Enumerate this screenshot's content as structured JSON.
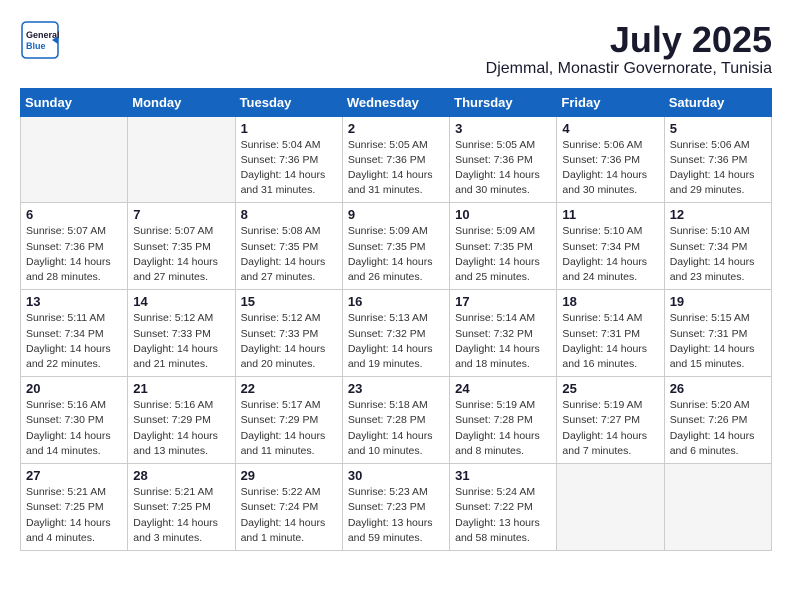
{
  "header": {
    "logo_general": "General",
    "logo_blue": "Blue",
    "month": "July 2025",
    "location": "Djemmal, Monastir Governorate, Tunisia"
  },
  "weekdays": [
    "Sunday",
    "Monday",
    "Tuesday",
    "Wednesday",
    "Thursday",
    "Friday",
    "Saturday"
  ],
  "weeks": [
    [
      {
        "day": "",
        "empty": true
      },
      {
        "day": "",
        "empty": true
      },
      {
        "day": "1",
        "sunrise": "5:04 AM",
        "sunset": "7:36 PM",
        "daylight": "14 hours and 31 minutes."
      },
      {
        "day": "2",
        "sunrise": "5:05 AM",
        "sunset": "7:36 PM",
        "daylight": "14 hours and 31 minutes."
      },
      {
        "day": "3",
        "sunrise": "5:05 AM",
        "sunset": "7:36 PM",
        "daylight": "14 hours and 30 minutes."
      },
      {
        "day": "4",
        "sunrise": "5:06 AM",
        "sunset": "7:36 PM",
        "daylight": "14 hours and 30 minutes."
      },
      {
        "day": "5",
        "sunrise": "5:06 AM",
        "sunset": "7:36 PM",
        "daylight": "14 hours and 29 minutes."
      }
    ],
    [
      {
        "day": "6",
        "sunrise": "5:07 AM",
        "sunset": "7:36 PM",
        "daylight": "14 hours and 28 minutes."
      },
      {
        "day": "7",
        "sunrise": "5:07 AM",
        "sunset": "7:35 PM",
        "daylight": "14 hours and 27 minutes."
      },
      {
        "day": "8",
        "sunrise": "5:08 AM",
        "sunset": "7:35 PM",
        "daylight": "14 hours and 27 minutes."
      },
      {
        "day": "9",
        "sunrise": "5:09 AM",
        "sunset": "7:35 PM",
        "daylight": "14 hours and 26 minutes."
      },
      {
        "day": "10",
        "sunrise": "5:09 AM",
        "sunset": "7:35 PM",
        "daylight": "14 hours and 25 minutes."
      },
      {
        "day": "11",
        "sunrise": "5:10 AM",
        "sunset": "7:34 PM",
        "daylight": "14 hours and 24 minutes."
      },
      {
        "day": "12",
        "sunrise": "5:10 AM",
        "sunset": "7:34 PM",
        "daylight": "14 hours and 23 minutes."
      }
    ],
    [
      {
        "day": "13",
        "sunrise": "5:11 AM",
        "sunset": "7:34 PM",
        "daylight": "14 hours and 22 minutes."
      },
      {
        "day": "14",
        "sunrise": "5:12 AM",
        "sunset": "7:33 PM",
        "daylight": "14 hours and 21 minutes."
      },
      {
        "day": "15",
        "sunrise": "5:12 AM",
        "sunset": "7:33 PM",
        "daylight": "14 hours and 20 minutes."
      },
      {
        "day": "16",
        "sunrise": "5:13 AM",
        "sunset": "7:32 PM",
        "daylight": "14 hours and 19 minutes."
      },
      {
        "day": "17",
        "sunrise": "5:14 AM",
        "sunset": "7:32 PM",
        "daylight": "14 hours and 18 minutes."
      },
      {
        "day": "18",
        "sunrise": "5:14 AM",
        "sunset": "7:31 PM",
        "daylight": "14 hours and 16 minutes."
      },
      {
        "day": "19",
        "sunrise": "5:15 AM",
        "sunset": "7:31 PM",
        "daylight": "14 hours and 15 minutes."
      }
    ],
    [
      {
        "day": "20",
        "sunrise": "5:16 AM",
        "sunset": "7:30 PM",
        "daylight": "14 hours and 14 minutes."
      },
      {
        "day": "21",
        "sunrise": "5:16 AM",
        "sunset": "7:29 PM",
        "daylight": "14 hours and 13 minutes."
      },
      {
        "day": "22",
        "sunrise": "5:17 AM",
        "sunset": "7:29 PM",
        "daylight": "14 hours and 11 minutes."
      },
      {
        "day": "23",
        "sunrise": "5:18 AM",
        "sunset": "7:28 PM",
        "daylight": "14 hours and 10 minutes."
      },
      {
        "day": "24",
        "sunrise": "5:19 AM",
        "sunset": "7:28 PM",
        "daylight": "14 hours and 8 minutes."
      },
      {
        "day": "25",
        "sunrise": "5:19 AM",
        "sunset": "7:27 PM",
        "daylight": "14 hours and 7 minutes."
      },
      {
        "day": "26",
        "sunrise": "5:20 AM",
        "sunset": "7:26 PM",
        "daylight": "14 hours and 6 minutes."
      }
    ],
    [
      {
        "day": "27",
        "sunrise": "5:21 AM",
        "sunset": "7:25 PM",
        "daylight": "14 hours and 4 minutes."
      },
      {
        "day": "28",
        "sunrise": "5:21 AM",
        "sunset": "7:25 PM",
        "daylight": "14 hours and 3 minutes."
      },
      {
        "day": "29",
        "sunrise": "5:22 AM",
        "sunset": "7:24 PM",
        "daylight": "14 hours and 1 minute."
      },
      {
        "day": "30",
        "sunrise": "5:23 AM",
        "sunset": "7:23 PM",
        "daylight": "13 hours and 59 minutes."
      },
      {
        "day": "31",
        "sunrise": "5:24 AM",
        "sunset": "7:22 PM",
        "daylight": "13 hours and 58 minutes."
      },
      {
        "day": "",
        "empty": true
      },
      {
        "day": "",
        "empty": true
      }
    ]
  ]
}
